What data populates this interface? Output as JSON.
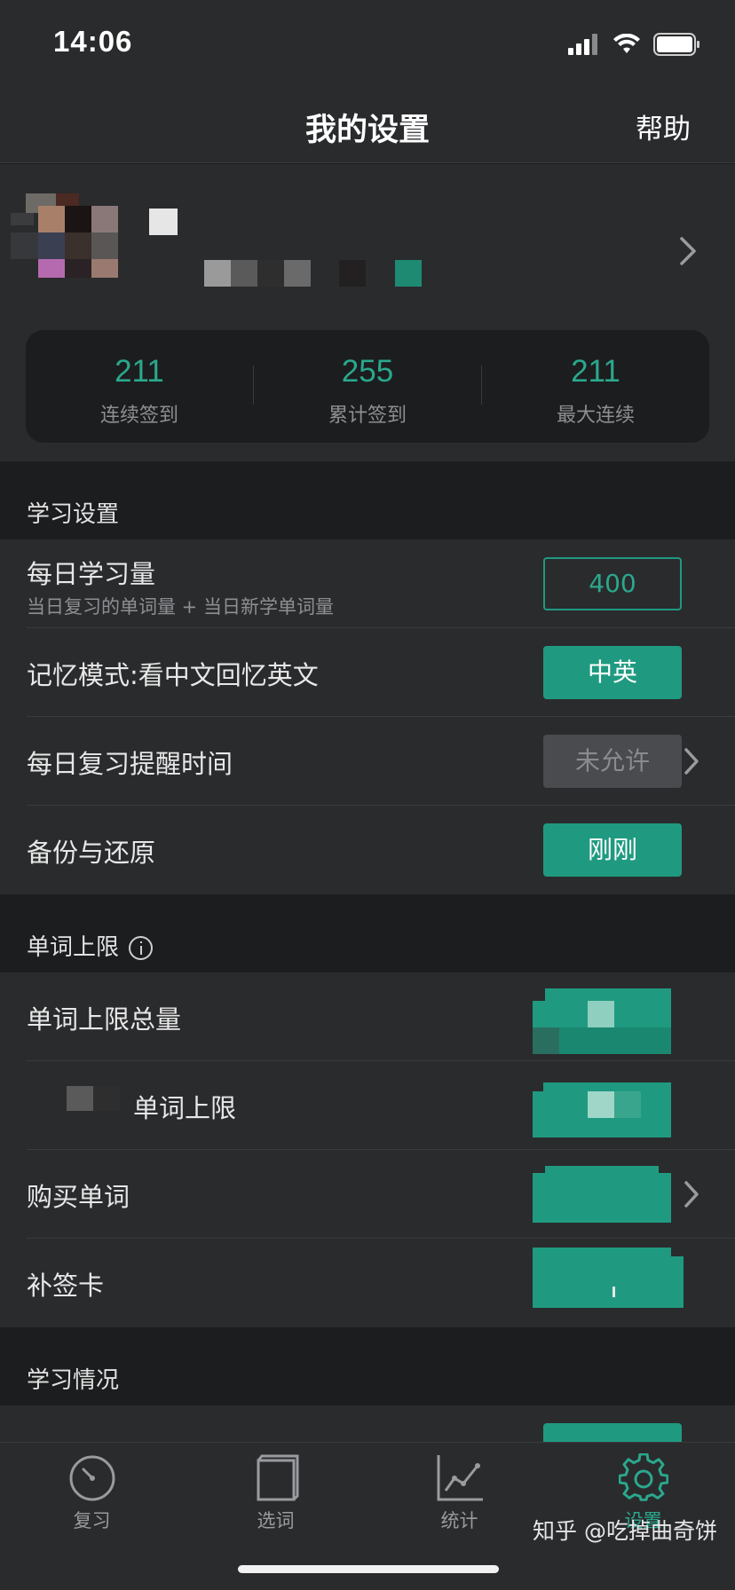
{
  "status": {
    "time": "14:06"
  },
  "nav": {
    "title": "我的设置",
    "help": "帮助"
  },
  "stats": [
    {
      "value": "211",
      "label": "连续签到"
    },
    {
      "value": "255",
      "label": "累计签到"
    },
    {
      "value": "211",
      "label": "最大连续"
    }
  ],
  "sections": {
    "study": "学习设置",
    "limit": "单词上限",
    "progress": "学习情况"
  },
  "rows": {
    "daily": {
      "label": "每日学习量",
      "sub": "当日复习的单词量 + 当日新学单词量",
      "value": "400"
    },
    "memory": {
      "label": "记忆模式:看中文回忆英文",
      "value": "中英"
    },
    "reminder": {
      "label": "每日复习提醒时间",
      "value": "未允许"
    },
    "backup": {
      "label": "备份与还原",
      "value": "刚刚"
    },
    "limitTotal": {
      "label": "单词上限总量"
    },
    "limitExtra": {
      "label": "单词上限"
    },
    "buy": {
      "label": "购买单词"
    },
    "makeup": {
      "label": "补签卡"
    }
  },
  "tabs": [
    {
      "label": "复习",
      "icon": "speedometer-icon"
    },
    {
      "label": "选词",
      "icon": "book-icon"
    },
    {
      "label": "统计",
      "icon": "chart-icon"
    },
    {
      "label": "设置",
      "icon": "gear-icon"
    }
  ],
  "watermark": "知乎 @吃掉曲奇饼",
  "colors": {
    "accent": "#1f9a80",
    "background": "#1c1d1f",
    "card": "#2a2b2d"
  }
}
